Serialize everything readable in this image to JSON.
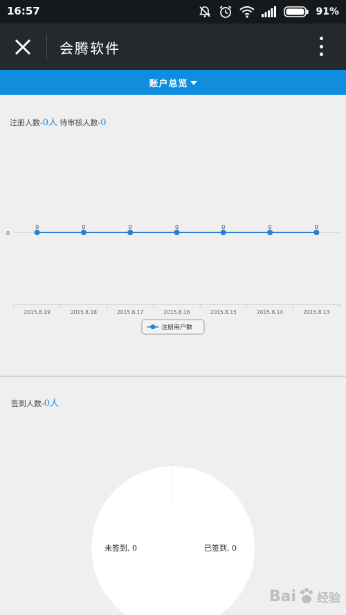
{
  "status_bar": {
    "time": "16:57",
    "battery": "91%",
    "icons": [
      "mute-icon",
      "alarm-icon",
      "wifi-icon",
      "signal-icon",
      "battery-icon"
    ]
  },
  "app_bar": {
    "title": "会腾软件",
    "close_icon": "close-icon",
    "more_icon": "more-vertical-icon"
  },
  "tab_bar": {
    "label": "账户总览"
  },
  "registration": {
    "registered_label": "注册人数-",
    "registered_count": "0",
    "registered_unit": "人",
    "pending_label": "待审核人数-",
    "pending_count": "0"
  },
  "chart_data": {
    "type": "line",
    "categories": [
      "2015.8.19",
      "2015.8.18",
      "2015.8.17",
      "2015.8.16",
      "2015.8.15",
      "2015.8.14",
      "2015.8.13"
    ],
    "series": [
      {
        "name": "注册用户数",
        "values": [
          0,
          0,
          0,
          0,
          0,
          0,
          0
        ]
      }
    ],
    "yticks": [
      "0"
    ],
    "data_labels": true,
    "legend_position": "bottom-center",
    "series_color": "#2a7fd4"
  },
  "sign_in": {
    "label": "签到人数-",
    "count": "0",
    "unit": "人",
    "pie": {
      "not_signed_label": "未签到, 0",
      "signed_label": "已签到, 0"
    }
  },
  "watermark": {
    "text1": "Bai",
    "text2": "经验"
  }
}
